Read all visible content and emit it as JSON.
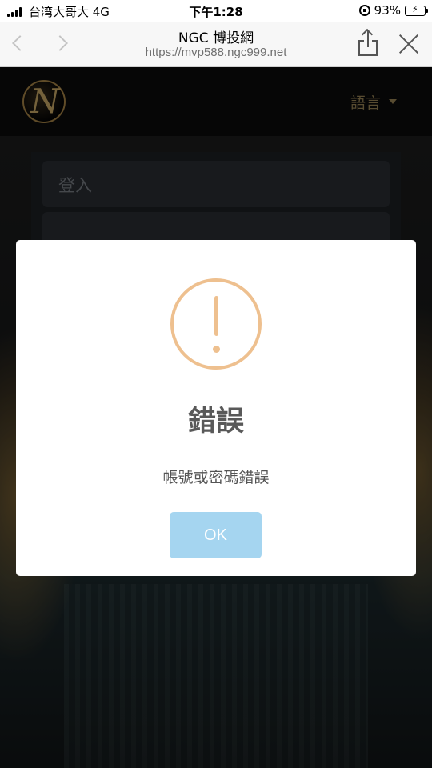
{
  "status_bar": {
    "carrier": "台湾大哥大  4G",
    "time": "下午1:28",
    "battery": "93%",
    "battery_level": 0.93
  },
  "browser": {
    "title": "NGC 博投網",
    "url": "https://mvp588.ngc999.net"
  },
  "site": {
    "logo_letter": "N",
    "language_label": "語言"
  },
  "login": {
    "title": "登入"
  },
  "dialog": {
    "title": "錯誤",
    "message": "帳號或密碼錯誤",
    "ok_label": "OK",
    "icon": "warning-exclamation-icon",
    "icon_color": "#eec08f",
    "button_color": "#a5d5f0"
  }
}
